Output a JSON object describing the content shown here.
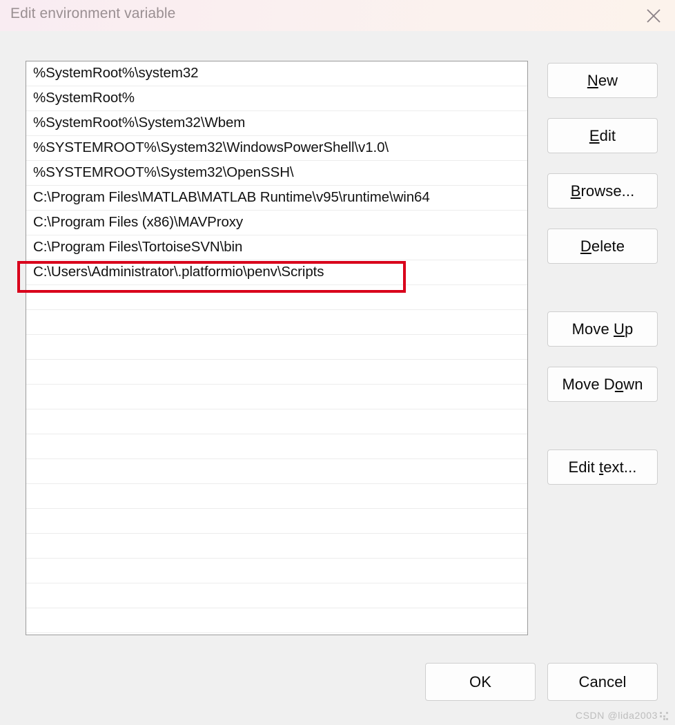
{
  "window": {
    "title": "Edit environment variable",
    "close_icon": "close-icon"
  },
  "path_list": {
    "entries": [
      "%SystemRoot%\\system32",
      "%SystemRoot%",
      "%SystemRoot%\\System32\\Wbem",
      "%SYSTEMROOT%\\System32\\WindowsPowerShell\\v1.0\\",
      "%SYSTEMROOT%\\System32\\OpenSSH\\",
      "C:\\Program Files\\MATLAB\\MATLAB Runtime\\v95\\runtime\\win64",
      "C:\\Program Files (x86)\\MAVProxy",
      "C:\\Program Files\\TortoiseSVN\\bin",
      "C:\\Users\\Administrator\\.platformio\\penv\\Scripts"
    ],
    "empty_row_count": 14,
    "highlighted_index": 8,
    "highlight_color": "#d9001b"
  },
  "side_buttons": {
    "new": {
      "pre": "",
      "accel": "N",
      "post": "ew"
    },
    "edit": {
      "pre": "",
      "accel": "E",
      "post": "dit"
    },
    "browse": {
      "pre": "",
      "accel": "B",
      "post": "rowse..."
    },
    "delete": {
      "pre": "",
      "accel": "D",
      "post": "elete"
    },
    "move_up": {
      "pre": "Move ",
      "accel": "U",
      "post": "p"
    },
    "move_down": {
      "pre": "Move D",
      "accel": "o",
      "post": "wn"
    },
    "edit_text": {
      "pre": "Edit ",
      "accel": "t",
      "post": "ext..."
    }
  },
  "footer_buttons": {
    "ok": "OK",
    "cancel": "Cancel"
  },
  "watermark": {
    "text": "CSDN @lida2003"
  }
}
